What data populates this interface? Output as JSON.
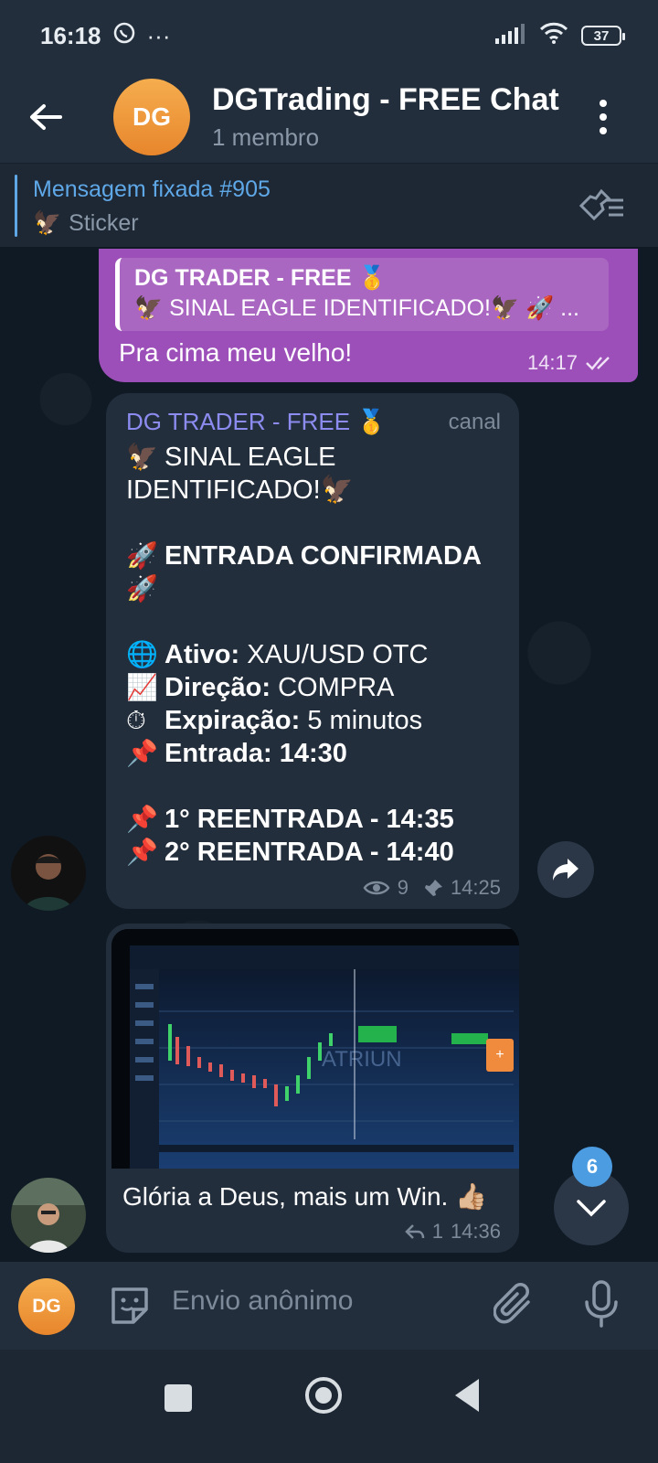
{
  "status_bar": {
    "time": "16:18",
    "battery": "37"
  },
  "header": {
    "avatar_initials": "DG",
    "title": "DGTrading - FREE Chat",
    "subtitle": "1 membro"
  },
  "pinned": {
    "title": "Mensagem fixada #905",
    "text": "Sticker"
  },
  "outgoing_message": {
    "reply_name": "DG TRADER - FREE 🥇",
    "reply_text": "🦅 SINAL EAGLE IDENTIFICADO!🦅  🚀 ...",
    "text": "Pra cima meu velho!",
    "time": "14:17"
  },
  "channel_post": {
    "sender": "DG TRADER - FREE 🥇",
    "tag": "canal",
    "lines": {
      "l1": "SINAL EAGLE",
      "l2": "IDENTIFICADO!",
      "l3": "ENTRADA CONFIRMADA",
      "ativo_label": "Ativo:",
      "ativo_value": " XAU/USD OTC",
      "direcao_label": "Direção:",
      "direcao_value": " COMPRA",
      "expiracao_label": "Expiração:",
      "expiracao_value": " 5 minutos",
      "entrada_label": "Entrada:",
      "entrada_value": "  14:30",
      "reentrada1": "1° REENTRADA -   14:35",
      "reentrada2": "2° REENTRADA -  14:40"
    },
    "views": "9",
    "time": "14:25"
  },
  "photo_message": {
    "photo_watermark": "ATRIUN",
    "caption": "Glória a Deus, mais um Win. 👍🏼",
    "replies": "1",
    "time": "14:36"
  },
  "unread_count": "6",
  "input": {
    "avatar_initials": "DG",
    "placeholder": "Envio anônimo"
  }
}
